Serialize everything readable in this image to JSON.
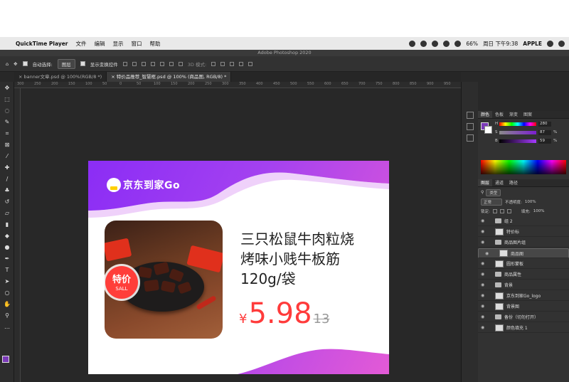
{
  "menubar": {
    "apple": "",
    "app": "QuickTime Player",
    "items": [
      "文件",
      "编辑",
      "显示",
      "窗口",
      "帮助"
    ],
    "battery": "66%",
    "clock": "周日 下午9:38",
    "user": "APPLE"
  },
  "window_title": "Adobe Photoshop 2020",
  "options": {
    "auto_select_label": "自动选择:",
    "auto_select_value": "图层",
    "show_transform_label": "显示变换控件",
    "mode_3d": "3D 模式:"
  },
  "tabs": [
    {
      "label": "banner文章.psd @ 100%(RGB/8 *)",
      "close": "×"
    },
    {
      "label": "特价品推荐_智慧框.psd @ 100% (商品图, RGB/8) *",
      "close": "×"
    }
  ],
  "ruler_ticks": [
    "300",
    "250",
    "200",
    "150",
    "100",
    "50",
    "0",
    "50",
    "100",
    "150",
    "200",
    "250",
    "300",
    "350",
    "400",
    "450",
    "500",
    "550",
    "600",
    "650",
    "700",
    "750",
    "800",
    "850",
    "900",
    "950"
  ],
  "banner": {
    "logo_text": "京东到家Go",
    "product_title_line1": "三只松鼠牛肉粒烧",
    "product_title_line2": "烤味小贱牛板筋",
    "product_title_line3": "120g/袋",
    "currency": "¥",
    "price": "5.98",
    "original_price": "13",
    "badge_main": "特价",
    "badge_sub": "SALL",
    "colors": {
      "gradient_start": "#8b2df5",
      "gradient_end": "#e35ad6",
      "price": "#ff3b3b",
      "badge": "#ff3e3a"
    }
  },
  "color_panel": {
    "tabs": [
      "颜色",
      "色板",
      "渐变",
      "图案"
    ],
    "values": [
      "280",
      "87",
      "59"
    ],
    "units": [
      "",
      "%",
      "%"
    ],
    "labels": [
      "H",
      "S",
      "B"
    ]
  },
  "layers_panel": {
    "tabs": [
      "图层",
      "通道",
      "路径"
    ],
    "filter": "类型",
    "blend_mode": "正常",
    "opacity_label": "不透明度:",
    "opacity": "100%",
    "lock_label": "锁定:",
    "fill_label": "填充:",
    "fill": "100%",
    "layers": [
      {
        "name": "组 2",
        "kind": "folder"
      },
      {
        "name": "特价标",
        "kind": "layer"
      },
      {
        "name": "商品图片组",
        "kind": "folder"
      },
      {
        "name": "商品图",
        "kind": "layer",
        "selected": true
      },
      {
        "name": "圆形蒙板",
        "kind": "layer"
      },
      {
        "name": "商品属性",
        "kind": "folder"
      },
      {
        "name": "背景",
        "kind": "folder"
      },
      {
        "name": "京东到家Go_logo",
        "kind": "layer"
      },
      {
        "name": "背景图",
        "kind": "layer"
      },
      {
        "name": "备份（切勿打开）",
        "kind": "folder"
      },
      {
        "name": "颜色填充 1",
        "kind": "layer"
      }
    ]
  }
}
